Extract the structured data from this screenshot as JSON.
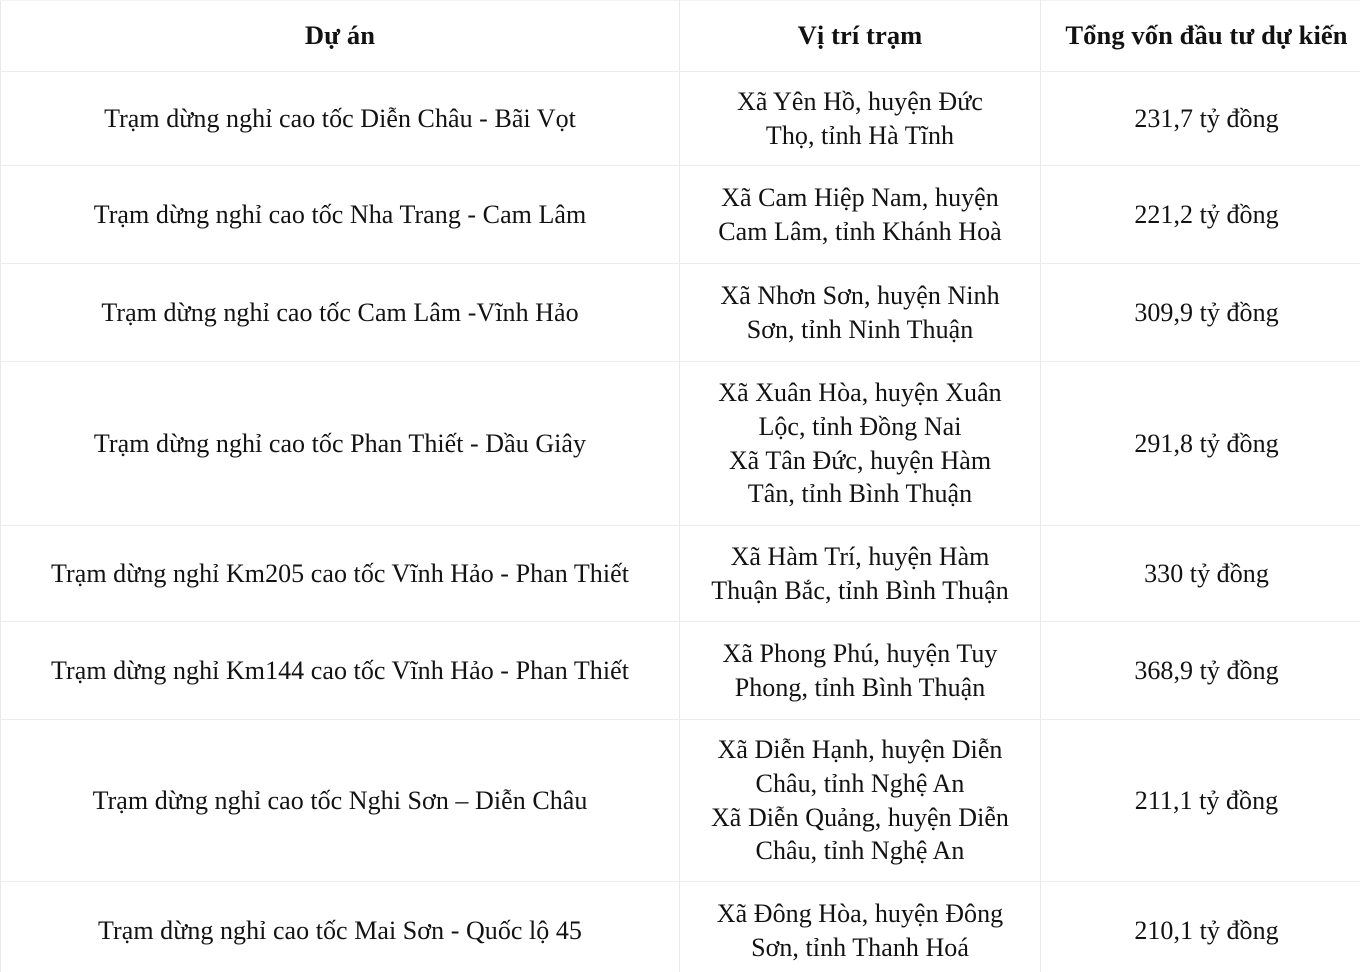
{
  "table": {
    "columns": [
      {
        "key": "project",
        "label": "Dự án"
      },
      {
        "key": "location",
        "label": "Vị trí trạm"
      },
      {
        "key": "capital",
        "label": "Tổng vốn đầu tư dự kiến"
      }
    ],
    "rows": [
      {
        "project": "Trạm dừng nghỉ cao tốc Diễn Châu - Bãi Vọt",
        "location": "Xã Yên Hồ, huyện Đức\nThọ, tỉnh Hà Tĩnh",
        "capital": "231,7 tỷ đồng"
      },
      {
        "project": "Trạm dừng nghỉ cao tốc Nha Trang - Cam Lâm",
        "location": "Xã Cam Hiệp Nam, huyện\nCam Lâm, tỉnh Khánh Hoà",
        "capital": "221,2 tỷ đồng"
      },
      {
        "project": "Trạm dừng nghỉ cao tốc Cam Lâm -Vĩnh Hảo",
        "location": "Xã Nhơn Sơn, huyện Ninh\nSơn, tỉnh Ninh Thuận",
        "capital": "309,9 tỷ đồng"
      },
      {
        "project": "Trạm dừng nghỉ cao tốc Phan Thiết - Dầu Giây",
        "location": "Xã Xuân Hòa, huyện Xuân\nLộc, tỉnh Đồng Nai\nXã Tân Đức, huyện Hàm\nTân, tỉnh Bình Thuận",
        "capital": "291,8 tỷ đồng"
      },
      {
        "project": "Trạm dừng nghỉ Km205 cao tốc Vĩnh Hảo - Phan Thiết",
        "location": "Xã Hàm Trí, huyện Hàm\nThuận Bắc, tỉnh Bình Thuận",
        "capital": "330 tỷ đồng"
      },
      {
        "project": "Trạm dừng nghỉ Km144 cao tốc Vĩnh Hảo - Phan Thiết",
        "location": "Xã Phong Phú, huyện Tuy\nPhong, tỉnh Bình Thuận",
        "capital": "368,9 tỷ đồng"
      },
      {
        "project": "Trạm dừng nghỉ cao tốc Nghi Sơn – Diễn Châu",
        "location": "Xã Diễn Hạnh, huyện Diễn\nChâu, tỉnh Nghệ An\nXã Diễn Quảng, huyện Diễn\nChâu, tỉnh Nghệ An",
        "capital": "211,1 tỷ đồng"
      },
      {
        "project": "Trạm dừng nghỉ cao tốc Mai Sơn - Quốc lộ 45",
        "location": "Xã Đông Hòa, huyện Đông\nSơn, tỉnh Thanh Hoá",
        "capital": "210,1 tỷ đồng"
      }
    ]
  },
  "colors": {
    "text": "#121212",
    "border": "#ececed",
    "background": "#ffffff"
  }
}
